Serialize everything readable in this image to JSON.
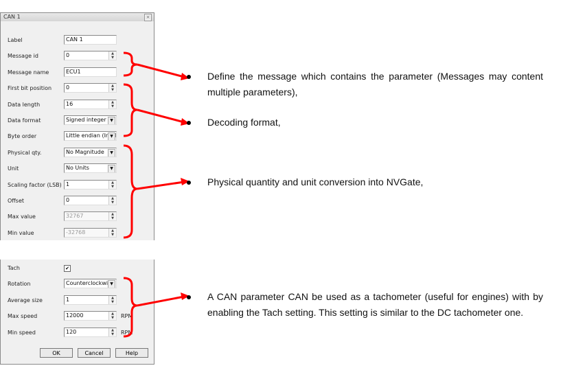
{
  "dialog": {
    "title": "CAN 1",
    "close": "×",
    "rows": [
      {
        "label": "Label",
        "value": "CAN 1",
        "kind": "text"
      },
      {
        "label": "Message id",
        "value": "0",
        "kind": "spin"
      },
      {
        "label": "Message name",
        "value": "ECU1",
        "kind": "text"
      },
      {
        "label": "First bit position",
        "value": "0",
        "kind": "spin"
      },
      {
        "label": "Data length",
        "value": "16",
        "kind": "spin"
      },
      {
        "label": "Data format",
        "value": "Signed integer",
        "kind": "select"
      },
      {
        "label": "Byte order",
        "value": "Little endian (Intel",
        "kind": "select"
      },
      {
        "label": "Physical qty.",
        "value": "No Magnitude",
        "kind": "select"
      },
      {
        "label": "Unit",
        "value": "No Units",
        "kind": "select"
      },
      {
        "label": "Scaling factor (LSB)",
        "value": "1",
        "kind": "spin"
      },
      {
        "label": "Offset",
        "value": "0",
        "kind": "spin"
      },
      {
        "label": "Max value",
        "value": "32767",
        "kind": "spin",
        "disabled": true
      },
      {
        "label": "Min value",
        "value": "-32768",
        "kind": "spin",
        "disabled": true
      }
    ]
  },
  "tach": {
    "label": "Tach",
    "checked": true,
    "rows": [
      {
        "label": "Rotation",
        "value": "Counterclockwise",
        "kind": "select"
      },
      {
        "label": "Average size",
        "value": "1",
        "kind": "spin"
      },
      {
        "label": "Max speed",
        "value": "12000",
        "kind": "spin",
        "unit": "RPM"
      },
      {
        "label": "Min speed",
        "value": "120",
        "kind": "spin",
        "unit": "RPM"
      }
    ],
    "buttons": {
      "ok": "OK",
      "cancel": "Cancel",
      "help": "Help"
    }
  },
  "annotations": [
    "Define the message which contains the parameter (Messages may content multiple parameters),",
    "Decoding format,",
    "Physical quantity and unit conversion into NVGate,",
    "A CAN parameter CAN be used as a tachometer (useful for engines) with by enabling the Tach setting. This setting is similar to the DC tachometer one."
  ],
  "annotation_color": "#ff0000"
}
